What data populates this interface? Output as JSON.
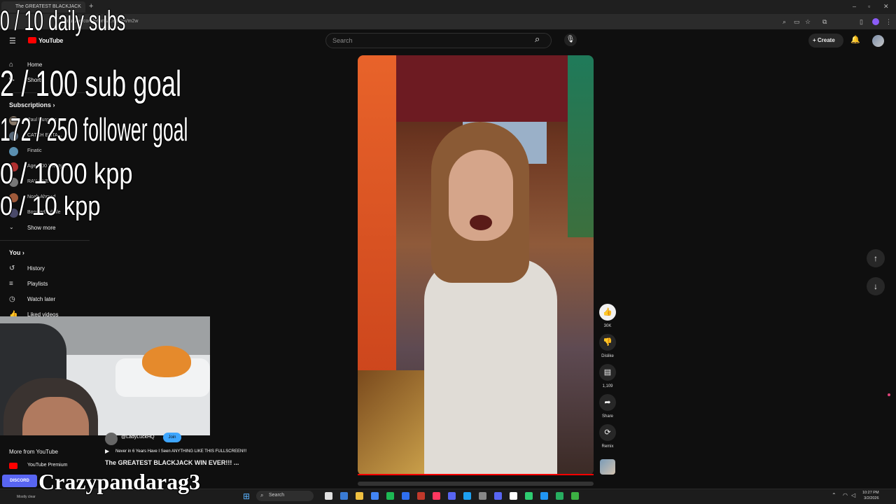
{
  "browser": {
    "tab_title": "The GREATEST BLACKJACK",
    "tab_new": "+",
    "url": "youtube.com/shorts/...emspVm2w",
    "win_min": "–",
    "win_max": "▫",
    "win_close": "✕"
  },
  "header": {
    "logo_text": "YouTube",
    "search_placeholder": "Search",
    "create_label": "+ Create"
  },
  "sidebar": {
    "items": [
      {
        "label": "Home"
      },
      {
        "label": "Shorts"
      }
    ],
    "subscriptions_header": "Subscriptions  ›",
    "channels": [
      {
        "name": "Paul Burgess",
        "color": "#8a7a6a"
      },
      {
        "name": "CATCH ENTA...",
        "color": "#556677"
      },
      {
        "name": "Finatic",
        "color": "#5a8fb0"
      },
      {
        "name": "Agent 00 Lifestyle",
        "color": "#b03030"
      },
      {
        "name": "RAY LIVE",
        "color": "#777777"
      },
      {
        "name": "Noah Ahmed",
        "color": "#a05a3a"
      },
      {
        "name": "BoostedBubble",
        "color": "#4a4a6a"
      }
    ],
    "show_more": "Show more",
    "you_header": "You  ›",
    "you_items": [
      {
        "label": "History"
      },
      {
        "label": "Playlists"
      },
      {
        "label": "Watch later"
      },
      {
        "label": "Liked videos"
      }
    ],
    "more_header": "More from YouTube",
    "more_items": [
      {
        "label": "YouTube Premium"
      }
    ]
  },
  "overlay_goals": {
    "daily_subs": "0 / 10 daily subs",
    "sub_goal": "2  / 100 sub goal",
    "follower_goal": "172 / 250 follower goal",
    "kpp_1000": "0 / 1000 kpp",
    "kpp_10": "0 / 10 kpp"
  },
  "short": {
    "actions": {
      "like_count": "30K",
      "dislike_label": "Dislike",
      "comment_count": "1,109",
      "share_label": "Share",
      "remix_label": "Remix"
    },
    "channel_handle": "@LadyLuckHQ",
    "join_label": "Join",
    "description": "Never in 6 Years Have I Seen ANYTHING LIKE THIS FULLSCREEN!!!",
    "title": "The GREATEST BLACKJACK WIN EVER!!! ..."
  },
  "stream_overlay": {
    "discord_label": "DISCORD",
    "username": "Crazypandarag3"
  },
  "taskbar": {
    "weather": "Mostly clear",
    "search_label": "Search",
    "time": "10:27 PM",
    "date": "3/2/2026",
    "icons": [
      "#e0e0e0",
      "#3a7bd5",
      "#f0c040",
      "#4285f4",
      "#1db954",
      "#2f6fef",
      "#c0392b",
      "#ff3860",
      "#5865f2",
      "#1da1f2",
      "#888888",
      "#5865f2",
      "#ffffff",
      "#2ecc71",
      "#2196f3",
      "#27ae60",
      "#3cb043"
    ]
  },
  "colors": {
    "accent_red": "#ff0000",
    "join_blue": "#3ea6ff",
    "background": "#0f0f0f"
  }
}
